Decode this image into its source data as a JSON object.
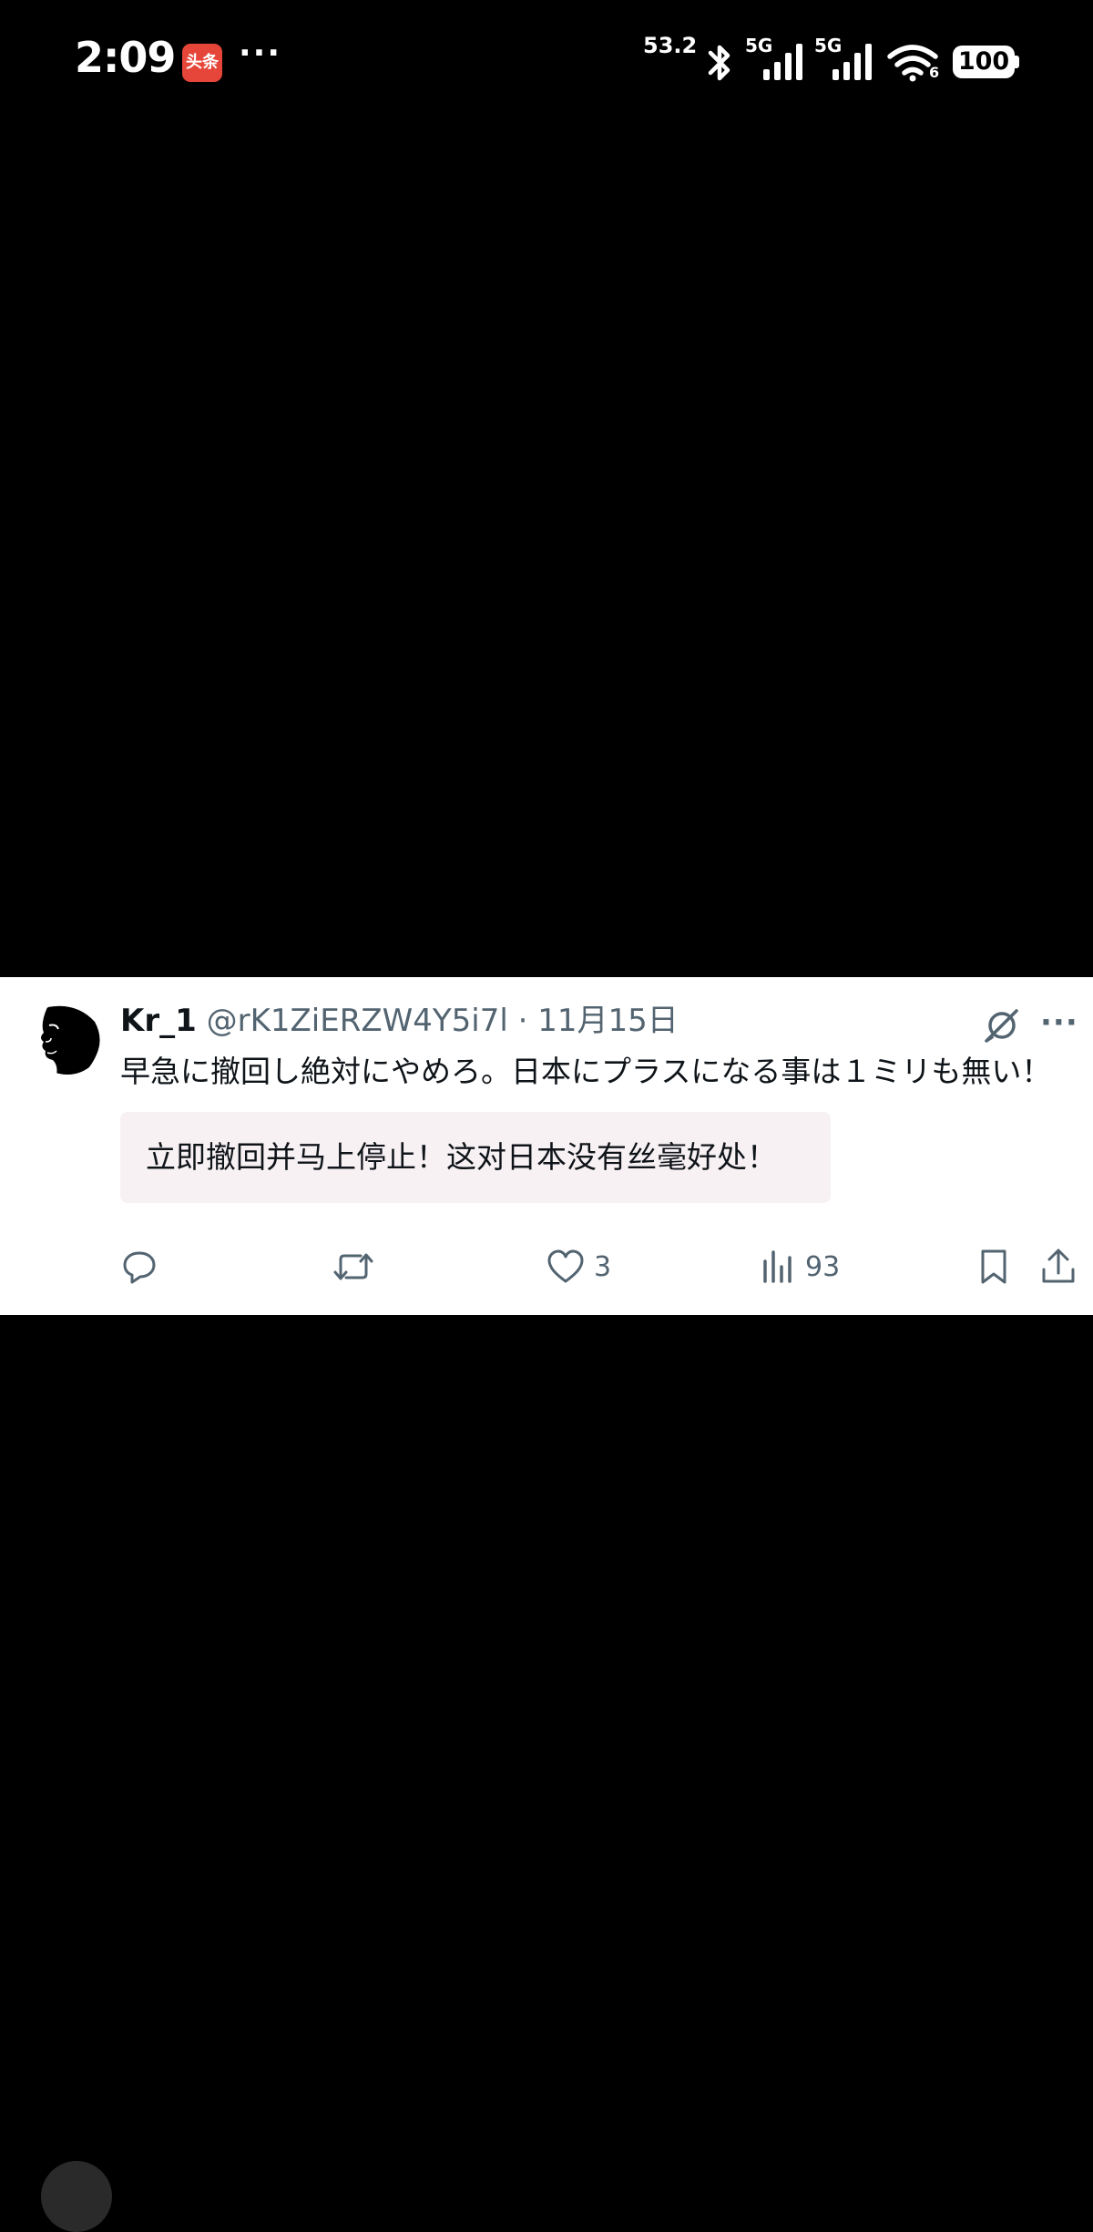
{
  "status_bar": {
    "time": "2:09",
    "app_badge": "头条",
    "more": "···",
    "net_speed": "53.2",
    "net_unit": "",
    "sim1": "5G",
    "sim2": "5G",
    "wifi_badge": "6",
    "battery": "100"
  },
  "tweet": {
    "author_name": "Kr_1",
    "author_handle": "@rK1ZiERZW4Y5i7l",
    "separator": "·",
    "date": "11月15日",
    "text": "早急に撤回し絶対にやめろ。日本にプラスになる事は１ミリも無い！",
    "translation": "立即撤回并马上停止！这对日本没有丝毫好处！",
    "actions": {
      "reply_count": "",
      "retweet_count": "",
      "like_count": "3",
      "views_count": "93"
    }
  },
  "colors": {
    "background": "#000000",
    "card": "#ffffff",
    "secondary_text": "#536471",
    "translation_bg": "#f7f1f3"
  },
  "icons": [
    "toutiao-app-icon",
    "bluetooth-icon",
    "signal-icon",
    "wifi-icon",
    "battery-icon",
    "grok-icon",
    "more-icon",
    "reply-icon",
    "retweet-icon",
    "like-icon",
    "views-icon",
    "bookmark-icon",
    "share-icon"
  ]
}
